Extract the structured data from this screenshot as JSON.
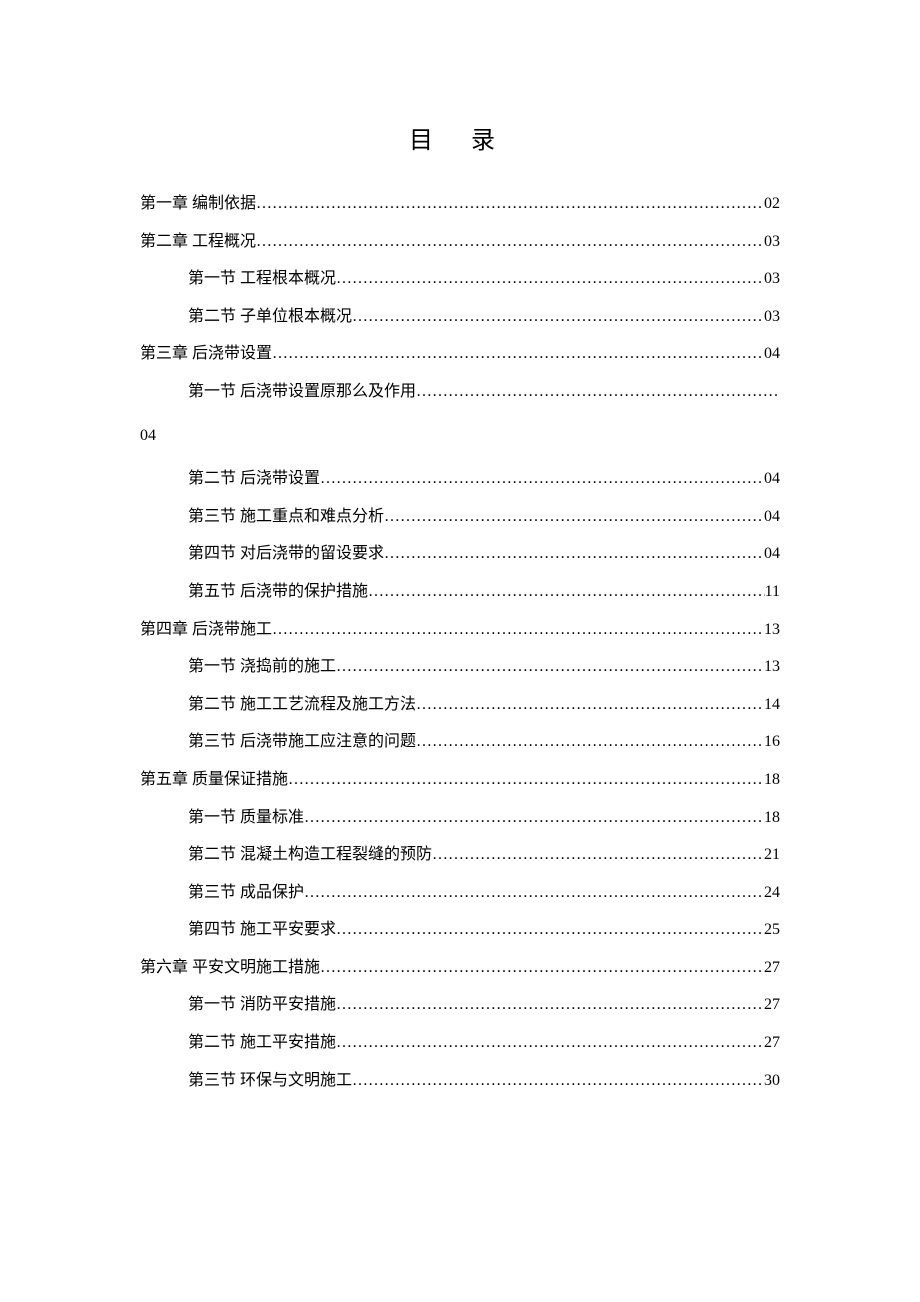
{
  "title": "目  录",
  "entries": [
    {
      "level": 1,
      "label": "第一章 编制依据",
      "page": "02"
    },
    {
      "level": 1,
      "label": "第二章 工程概况",
      "page": "03"
    },
    {
      "level": 2,
      "label": "第一节 工程根本概况",
      "page": "03"
    },
    {
      "level": 2,
      "label": "第二节 子单位根本概况",
      "page": "03"
    },
    {
      "level": 1,
      "label": "第三章 后浇带设置",
      "page": "04"
    },
    {
      "level": 2,
      "label": "第一节 后浇带设置原那么及作用",
      "page": "",
      "orphan_page": "04"
    },
    {
      "level": 2,
      "label": "第二节 后浇带设置",
      "page": "04"
    },
    {
      "level": 2,
      "label": "第三节 施工重点和难点分析",
      "page": "04"
    },
    {
      "level": 2,
      "label": "第四节 对后浇带的留设要求",
      "page": "04"
    },
    {
      "level": 2,
      "label": "第五节 后浇带的保护措施",
      "page": "11"
    },
    {
      "level": 1,
      "label": "第四章 后浇带施工",
      "page": "13"
    },
    {
      "level": 2,
      "label": "第一节 浇捣前的施工",
      "page": "13"
    },
    {
      "level": 2,
      "label": "第二节 施工工艺流程及施工方法",
      "page": "14"
    },
    {
      "level": 2,
      "label": "第三节 后浇带施工应注意的问题",
      "page": "16"
    },
    {
      "level": 1,
      "label": "第五章 质量保证措施",
      "page": "18"
    },
    {
      "level": 2,
      "label": "第一节 质量标准",
      "page": "18"
    },
    {
      "level": 2,
      "label": "第二节 混凝土构造工程裂缝的预防",
      "page": "21"
    },
    {
      "level": 2,
      "label": "第三节 成品保护",
      "page": "24"
    },
    {
      "level": 2,
      "label": "第四节 施工平安要求",
      "page": "25"
    },
    {
      "level": 1,
      "label": "第六章 平安文明施工措施",
      "page": "27"
    },
    {
      "level": 2,
      "label": "第一节 消防平安措施",
      "page": "27"
    },
    {
      "level": 2,
      "label": "第二节 施工平安措施",
      "page": "27"
    },
    {
      "level": 2,
      "label": "第三节 环保与文明施工",
      "page": "30"
    }
  ]
}
